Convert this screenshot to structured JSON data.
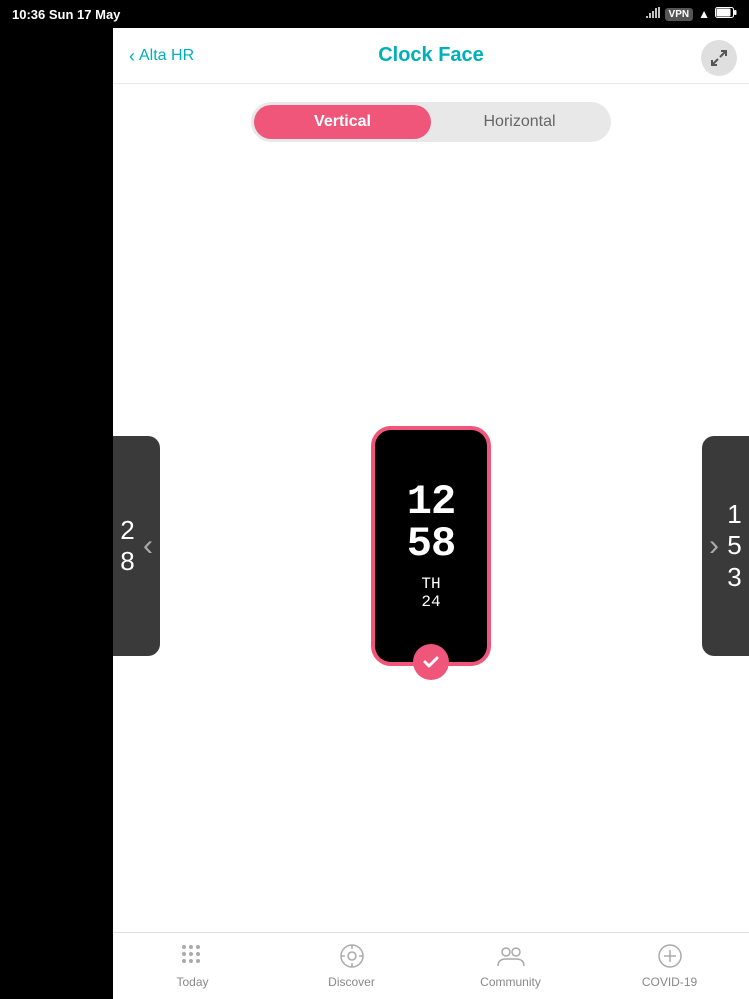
{
  "statusBar": {
    "time": "10:36",
    "date": "Sun 17 May",
    "battery": "86%",
    "signal": "▲",
    "vpn": "VPN"
  },
  "header": {
    "backLabel": "Alta HR",
    "title": "Clock Face"
  },
  "segment": {
    "options": [
      "Vertical",
      "Horizontal"
    ],
    "active": "Vertical"
  },
  "watch": {
    "hours": "12",
    "minutes": "58",
    "day": "TH",
    "date": "24"
  },
  "sidePanels": {
    "left": "2\n8",
    "right": "1\n5\n3"
  },
  "navigation": {
    "prev": "‹",
    "next": "›"
  },
  "tabBar": {
    "tabs": [
      {
        "id": "today",
        "label": "Today",
        "icon": "dots-grid"
      },
      {
        "id": "discover",
        "label": "Discover",
        "icon": "compass"
      },
      {
        "id": "community",
        "label": "Community",
        "icon": "people"
      },
      {
        "id": "covid19",
        "label": "COVID-19",
        "icon": "plus-circle"
      }
    ]
  }
}
